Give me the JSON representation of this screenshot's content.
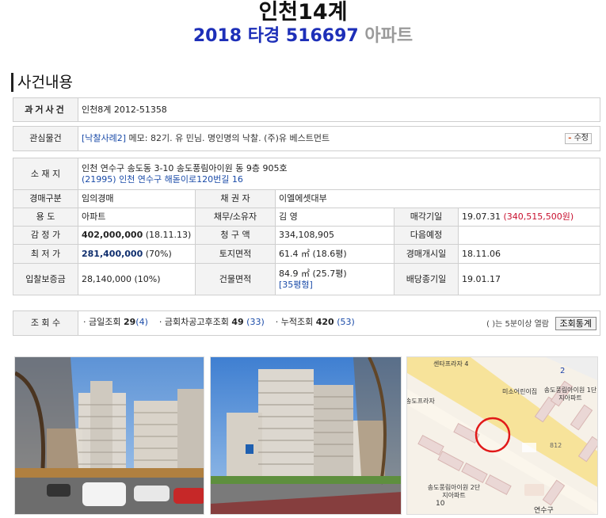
{
  "header": {
    "title": "인천14계",
    "subtitle_case": "2018 타경 516697",
    "subtitle_type": "아파트"
  },
  "section_title": "사건내용",
  "past_case": {
    "label": "과거사건",
    "value": "인천8계 2012-51358"
  },
  "interest": {
    "label": "관심물건",
    "link": "[낙찰사례2]",
    "memo": " 메모: 82기. 유    민님. 명인명의 낙찰. (주)유       베스트먼트",
    "button": "수정"
  },
  "details": {
    "location_label": "소 재 지",
    "location_addr": "인천 연수구 송도동 3-10 송도풍림아이원      동 9층 905호",
    "location_road": "(21995) 인천 연수구 해돋이로120번길 16",
    "auction_type_label": "경매구분",
    "auction_type": "임의경매",
    "creditor_label": "채 권 자",
    "creditor": "이엘에셋대부",
    "usage_label": "용 도",
    "usage": "아파트",
    "debtor_label": "채무/소유자",
    "debtor": "김    영",
    "sale_date_label": "매각기일",
    "sale_date": "19.07.31",
    "sale_price": "(340,515,500원)",
    "appraisal_label": "감 정 가",
    "appraisal_amount": "402,000,000",
    "appraisal_date": "(18.11.13)",
    "claim_label": "청 구 액",
    "claim": "334,108,905",
    "next_label": "다음예정",
    "next": "",
    "min_price_label": "최 저 가",
    "min_price": "281,400,000",
    "min_rate": "(70%)",
    "land_area_label": "토지면적",
    "land_area": "61.4 ㎡ (18.6평)",
    "start_label": "경매개시일",
    "start": "18.11.06",
    "deposit_label": "입찰보증금",
    "deposit": "28,140,000 (10%)",
    "building_area_label": "건물면적",
    "building_area": "84.9 ㎡ (25.7평)",
    "building_type": "[35평형]",
    "dividend_label": "배당종기일",
    "dividend": "19.01.17"
  },
  "views": {
    "label": "조 회 수",
    "today_label": "· 금일조회",
    "today": "29",
    "today_sub": "(4)",
    "since_label": "· 금회차공고후조회",
    "since": "49",
    "since_sub": "(33)",
    "total_label": "· 누적조회",
    "total": "420",
    "total_sub": "(53)",
    "note": "( )는 5분이상 열람",
    "button": "조회통계"
  },
  "map": {
    "label_plaza": "센타프라자 4",
    "label_plaza2": "송도프라자",
    "label_daycare": "미소어린이집",
    "label_apt1": "송도풍림아이원 1단지아파트",
    "label_apt2": "송도풍림아이원 2단지아파트",
    "label_office": "연수구",
    "label_no2": "2",
    "label_no10": "10",
    "label_812": "812"
  }
}
